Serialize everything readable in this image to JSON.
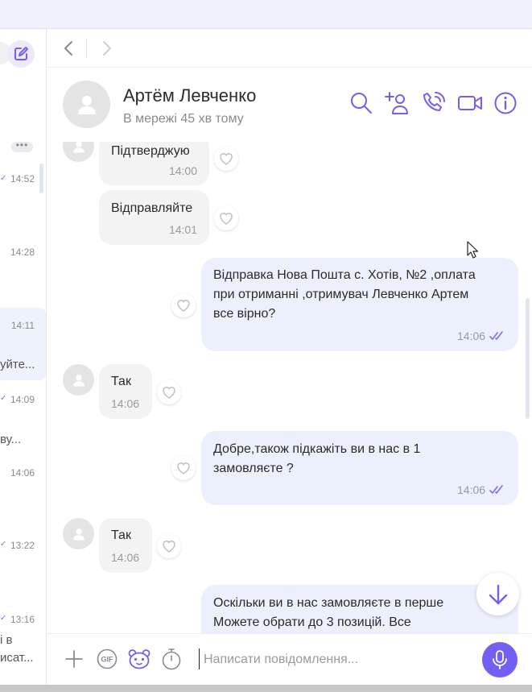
{
  "colors": {
    "accent": "#7360f2",
    "bubble_out": "#ecf0fd",
    "bubble_in": "#f3f3f3",
    "read_ticks": "#7f6ee8"
  },
  "sidebar": {
    "items": [
      {
        "time": "14:52",
        "snippet": ""
      },
      {
        "time": "14:28",
        "snippet": ""
      },
      {
        "time": "14:11",
        "snippet": "уйте..."
      },
      {
        "time": "14:09",
        "snippet": "ву..."
      },
      {
        "time": "14:06",
        "snippet": ""
      },
      {
        "time": "13:22",
        "snippet": ""
      },
      {
        "time": "13:16",
        "snippet": "і в",
        "snippet2": "исат..."
      }
    ]
  },
  "chat": {
    "contact_name": "Артём Левченко",
    "status": "В мережі 45 хв тому"
  },
  "messages": [
    {
      "direction": "in",
      "text": "Підтверджую",
      "time": "14:00"
    },
    {
      "direction": "in",
      "text": "Відправляйте",
      "time": "14:01"
    },
    {
      "direction": "out",
      "lines": [
        "Відправка Нова Пошта с. Хотів, №2 ,оплата",
        "при отриманні ,отримувач Левченко Артем",
        "все вірно?"
      ],
      "time": "14:06"
    },
    {
      "direction": "in",
      "text": "Так",
      "time": "14:06"
    },
    {
      "direction": "out",
      "lines": [
        "Добре,також підкажіть ви в нас в 1",
        "замовляєте ?"
      ],
      "time": "14:06"
    },
    {
      "direction": "in",
      "text": "Так",
      "time": "14:06"
    },
    {
      "direction": "out",
      "lines": [
        "Оскільки ви в нас замовляєте в перше",
        "Можете обрати до 3 позицій. Все"
      ],
      "time": ""
    }
  ],
  "composer": {
    "placeholder": "Написати повідомлення...",
    "gif_label": "GIF"
  }
}
